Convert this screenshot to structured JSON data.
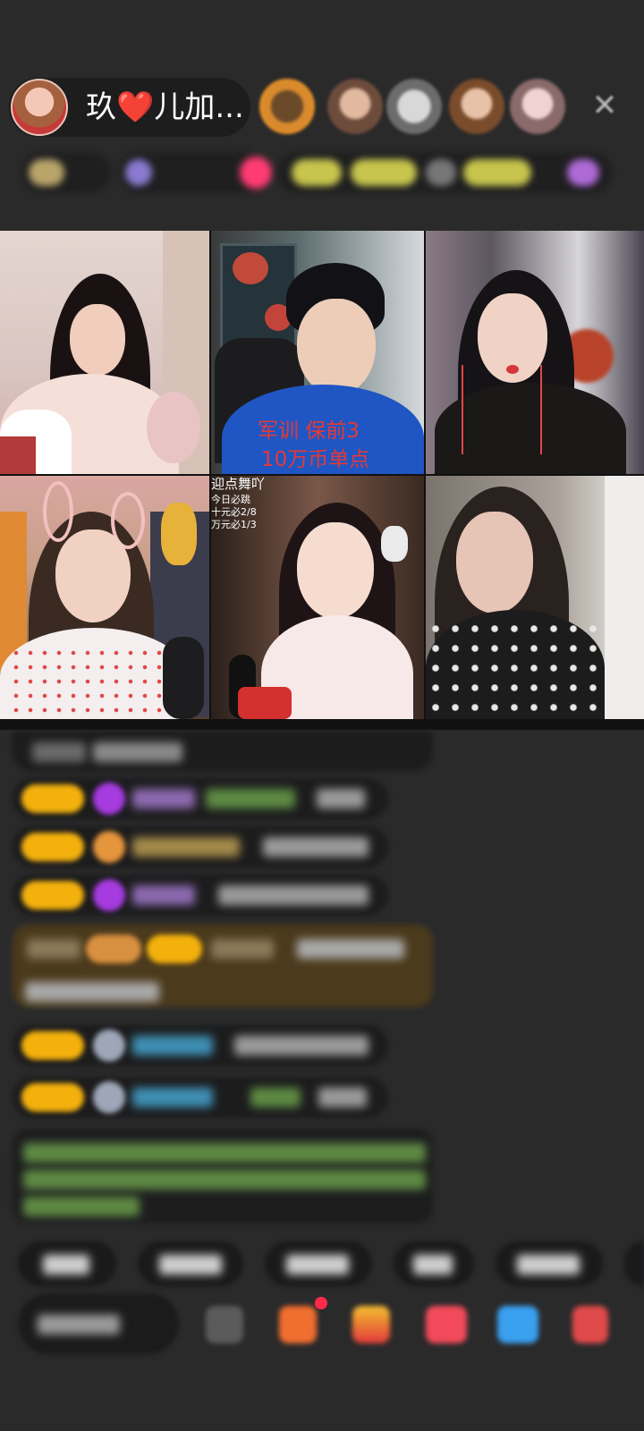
{
  "host": {
    "name": "玖❤️儿加..."
  },
  "viewers": [
    {
      "name": "viewer-1",
      "color": "#d98a2c"
    },
    {
      "name": "viewer-2",
      "color": "#8a6e60"
    },
    {
      "name": "viewer-3",
      "color": "#b9b9b9"
    },
    {
      "name": "viewer-4",
      "color": "#8a5d3c"
    },
    {
      "name": "viewer-5",
      "color": "#c9a7a7"
    }
  ],
  "grid": {
    "tile2_caption_line1": "军训 保前3",
    "tile2_caption_line2": "10万币单点",
    "tile5_menu_title": "迎点舞吖",
    "tile5_menu_lines": [
      "今日必跳",
      "十元必2/8",
      "万元必1/3"
    ]
  },
  "colors": {
    "badge": "#f4b10d",
    "accent_pink": "#ff3b73",
    "green_text": "#7fbf47",
    "background": "#2a2a2b"
  }
}
